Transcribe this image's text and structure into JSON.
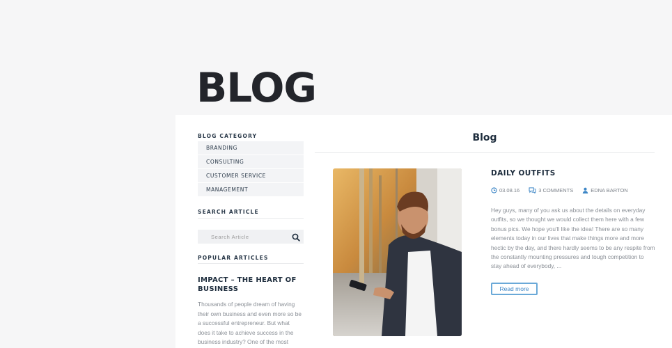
{
  "page": {
    "title": "BLOG"
  },
  "sidebar": {
    "category_heading": "BLOG CATEGORY",
    "categories": [
      {
        "label": "BRANDING"
      },
      {
        "label": "CONSULTING"
      },
      {
        "label": "CUSTOMER SERVICE"
      },
      {
        "label": "MANAGEMENT"
      }
    ],
    "search_heading": "SEARCH ARTICLE",
    "search_placeholder": "Search Article",
    "popular_heading": "POPULAR ARTICLES",
    "popular_article": {
      "title": "IMPACT – THE HEART OF BUSINESS",
      "excerpt": "Thousands of people dream of having their own business and even more so be a successful entrepreneur. But what does it take to achieve success in the business industry? One of the most successful"
    }
  },
  "main": {
    "heading": "Blog",
    "post": {
      "title": "DAILY OUTFITS",
      "date": "03.08.16",
      "comments": "3 COMMENTS",
      "author": "EDNA BARTON",
      "excerpt": "Hey guys, many of you ask us about the details on everyday outfits, so we thought we would collect them here with a few bonus pics. We hope you'll like the idea! There are so many elements today in our lives that make things more and more hectic by the day, and there hardly seems to be any respite from the constantly mounting pressures and tough competition to stay ahead of everybody, ...",
      "read_more": "Read more"
    }
  },
  "colors": {
    "accent": "#3d86c6",
    "heading": "#1e2d3d",
    "muted": "#8a8f96"
  },
  "icons": {
    "search": "search-icon",
    "date": "clock-icon",
    "comments": "comments-icon",
    "author": "user-icon"
  }
}
